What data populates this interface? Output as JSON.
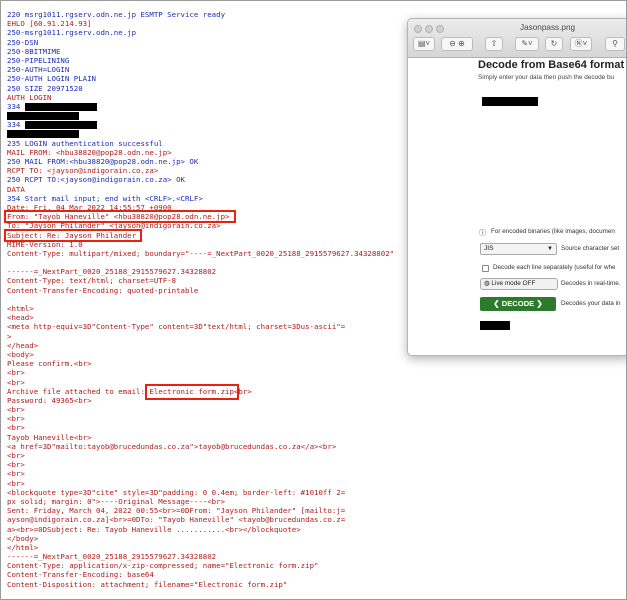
{
  "log_lines": [
    {
      "text": "220 msrg1011.rgserv.odn.ne.jp ESMTP Service ready",
      "kind": "srv"
    },
    {
      "text": "EHLO [60.91.214.93]",
      "kind": "cli"
    },
    {
      "text": "250-msrg1011.rgserv.odn.ne.jp",
      "kind": "srv"
    },
    {
      "text": "250-DSN",
      "kind": "srv"
    },
    {
      "text": "250-8BITMIME",
      "kind": "srv"
    },
    {
      "text": "250-PIPELINING",
      "kind": "srv"
    },
    {
      "text": "250-AUTH=LOGIN",
      "kind": "srv"
    },
    {
      "text": "250-AUTH LOGIN PLAIN",
      "kind": "srv"
    },
    {
      "text": "250 SIZE 20971520",
      "kind": "srv"
    },
    {
      "text": "AUTH LOGIN",
      "kind": "cli"
    },
    {
      "text": "334 ",
      "kind": "srv",
      "redact": true
    },
    {
      "text": "",
      "kind": "cli",
      "redact": true
    },
    {
      "text": "334 ",
      "kind": "srv",
      "redact": true
    },
    {
      "text": "",
      "kind": "cli",
      "redact": true
    },
    {
      "text": "235 LOGIN authentication successful",
      "kind": "srv"
    },
    {
      "text": "MAIL FROM: <hbu38820@pop28.odn.ne.jp>",
      "kind": "cli"
    },
    {
      "text": "250 MAIL FROM:<hbu38820@pop28.odn.ne.jp> OK",
      "kind": "srv"
    },
    {
      "text": "RCPT TO: <jayson@indigorain.co.za>",
      "kind": "cli"
    },
    {
      "text": "250 RCPT TO:<jayson@indigorain.co.za> OK",
      "kind": "srv"
    },
    {
      "text": "DATA",
      "kind": "cli"
    },
    {
      "text": "354 Start mail input; end with <CRLF>.<CRLF>",
      "kind": "srv"
    },
    {
      "text": "Date: Fri, 04 Mar 2022 14:55:57 +0900",
      "kind": "cli"
    },
    {
      "text": "From: \"Tayob Haneville\" <hbu38820@pop28.odn.ne.jp>",
      "kind": "cli"
    },
    {
      "text": "To: \"Jayson Philander\" <jayson@indigorain.co.za>",
      "kind": "cli"
    },
    {
      "text": "Subject: Re: Jayson Philander",
      "kind": "cli"
    },
    {
      "text": "MIME-Version: 1.0",
      "kind": "cli"
    },
    {
      "text": "Content-Type: multipart/mixed; boundary=\"----=_NextPart_0020_25188_2915579627.34328802\"",
      "kind": "cli"
    },
    {
      "text": "",
      "kind": "cli"
    },
    {
      "text": "------=_NextPart_0020_25188_2915579627.34328802",
      "kind": "cli"
    },
    {
      "text": "Content-Type: text/html; charset=UTF-8",
      "kind": "cli"
    },
    {
      "text": "Content-Transfer-Encoding: quoted-printable",
      "kind": "cli"
    },
    {
      "text": "",
      "kind": "cli"
    },
    {
      "text": "<html>",
      "kind": "cli"
    },
    {
      "text": "<head>",
      "kind": "cli"
    },
    {
      "text": "<meta http-equiv=3D\"Content-Type\" content=3D\"text/html; charset=3Dus-ascii\"=",
      "kind": "cli"
    },
    {
      "text": ">",
      "kind": "cli"
    },
    {
      "text": "</head>",
      "kind": "cli"
    },
    {
      "text": "<body>",
      "kind": "cli"
    },
    {
      "text": "Please confirm.<br>",
      "kind": "cli"
    },
    {
      "text": "<br>",
      "kind": "cli"
    },
    {
      "text": "<br>",
      "kind": "cli"
    },
    {
      "text": "Archive file attached to email: Electronic form.zip<br>",
      "kind": "cli"
    },
    {
      "text": "Password: 49365<br>",
      "kind": "cli"
    },
    {
      "text": "<br>",
      "kind": "cli"
    },
    {
      "text": "<br>",
      "kind": "cli"
    },
    {
      "text": "<br>",
      "kind": "cli"
    },
    {
      "text": "Tayob Haneville<br>",
      "kind": "cli"
    },
    {
      "text": "<a href=3D\"mailto:tayob@brucedundas.co.za\">tayob@brucedundas.co.za</a><br>",
      "kind": "cli"
    },
    {
      "text": "<br>",
      "kind": "cli"
    },
    {
      "text": "<br>",
      "kind": "cli"
    },
    {
      "text": "<br>",
      "kind": "cli"
    },
    {
      "text": "<br>",
      "kind": "cli"
    },
    {
      "text": "<blockquote type=3D\"cite\" style=3D\"padding: 0 0.4em; border-left: #1010ff 2=",
      "kind": "cli"
    },
    {
      "text": "px solid; margin: 0\">----Original Message----<br>",
      "kind": "cli"
    },
    {
      "text": "Sent: Friday, March 04, 2022 00:55<br>=0DFrom: \"Jayson Philander\" [mailto:j=",
      "kind": "cli"
    },
    {
      "text": "ayson@indigorain.co.za]<br>=0DTo: \"Tayob Haneville\" <tayob@brucedundas.co.z=",
      "kind": "cli"
    },
    {
      "text": "a><br>=0DSubject: Re: Tayob Haneville ...........<br></blockquote>",
      "kind": "cli"
    },
    {
      "text": "</body>",
      "kind": "cli"
    },
    {
      "text": "</html>",
      "kind": "cli"
    },
    {
      "text": "------=_NextPart_0020_25188_2915579627.34328802",
      "kind": "cli"
    },
    {
      "text": "Content-Type: application/x-zip-compressed; name=\"Electronic form.zip\"",
      "kind": "cli"
    },
    {
      "text": "Content-Transfer-Encoding: base64",
      "kind": "cli"
    },
    {
      "text": "Content-Disposition: attachment; filename=\"Electronic form.zip\"",
      "kind": "cli"
    }
  ],
  "colors": {
    "server": "#1c2cb3",
    "client": "#b01a1a",
    "highlight": "#e8220c",
    "decode_button": "#2d7a2d"
  },
  "window": {
    "title": "Jasonpass.png",
    "heading": "Decode from Base64 format",
    "subheading": "Simply enter your data then push the decode bu",
    "encoded_binaries_note": "For encoded binaries (like images, documen",
    "charset_value": "JIS",
    "charset_label": "Source character set",
    "decode_each_line": "Decode each line separately (useful for whe",
    "live_mode_button": "Live mode OFF",
    "live_mode_note": "Decodes in real-time.",
    "decode_button": "DECODE",
    "decode_note": "Decodes your data in"
  },
  "icons": [
    "sidebar-icon",
    "zoom-out-icon",
    "zoom-in-icon",
    "share-icon",
    "markup-pen-icon",
    "rotate-icon",
    "info-icon",
    "chevron-down-icon",
    "radio-icon",
    "toggle-icon"
  ]
}
